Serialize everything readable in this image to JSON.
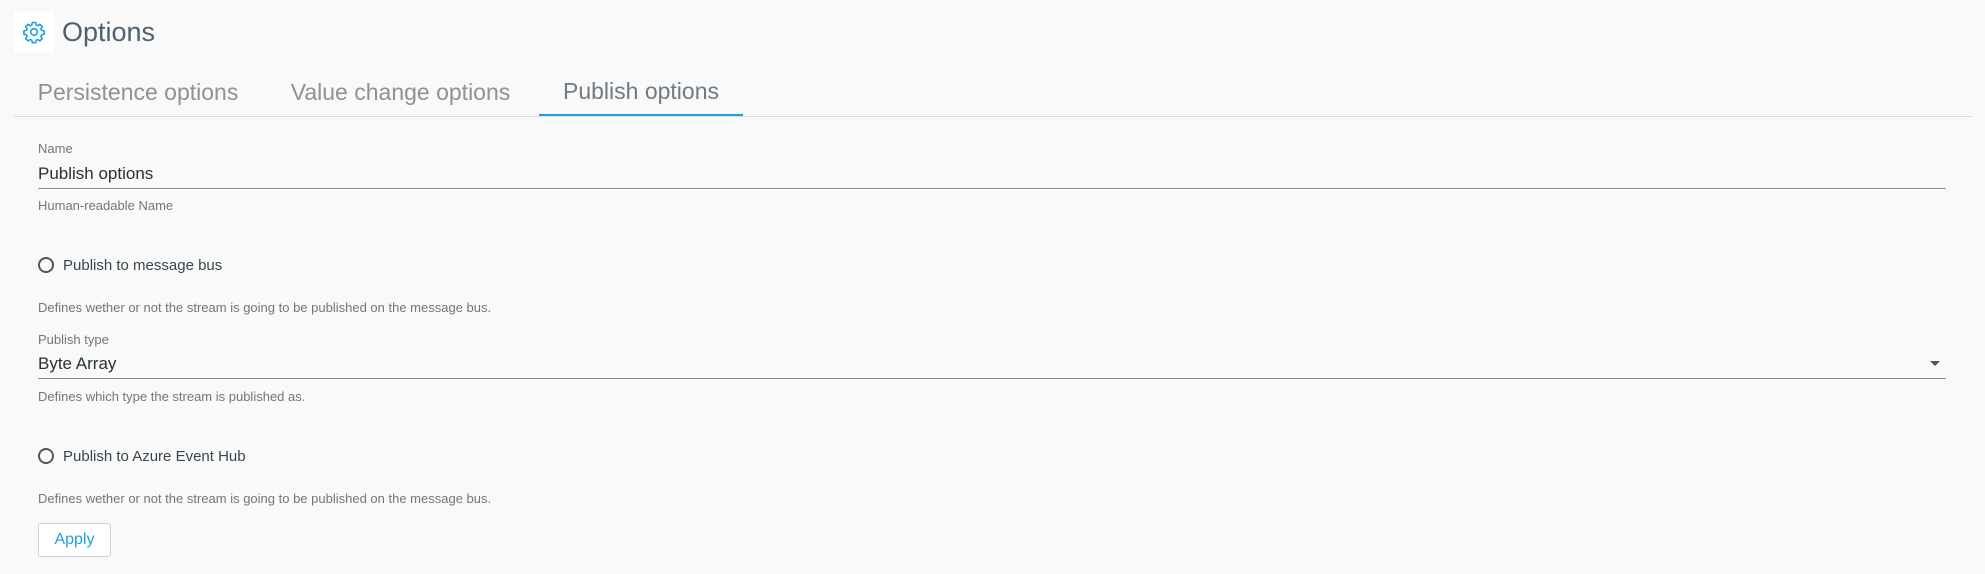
{
  "header": {
    "title": "Options",
    "icon": "gear-icon",
    "accent_color": "#1ba1e2"
  },
  "tabs": [
    {
      "label": "Persistence options",
      "active": false
    },
    {
      "label": "Value change options",
      "active": false
    },
    {
      "label": "Publish options",
      "active": true
    }
  ],
  "form": {
    "name": {
      "label": "Name",
      "value": "Publish options",
      "help": "Human-readable Name"
    },
    "publish_message_bus": {
      "label": "Publish to message bus",
      "checked": false,
      "help": "Defines wether or not the stream is going to be published on the message bus."
    },
    "publish_type": {
      "label": "Publish type",
      "value": "Byte Array",
      "help": "Defines which type the stream is published as."
    },
    "publish_azure": {
      "label": "Publish to Azure Event Hub",
      "checked": false,
      "help": "Defines wether or not the stream is going to be published on the message bus."
    },
    "apply_label": "Apply"
  }
}
